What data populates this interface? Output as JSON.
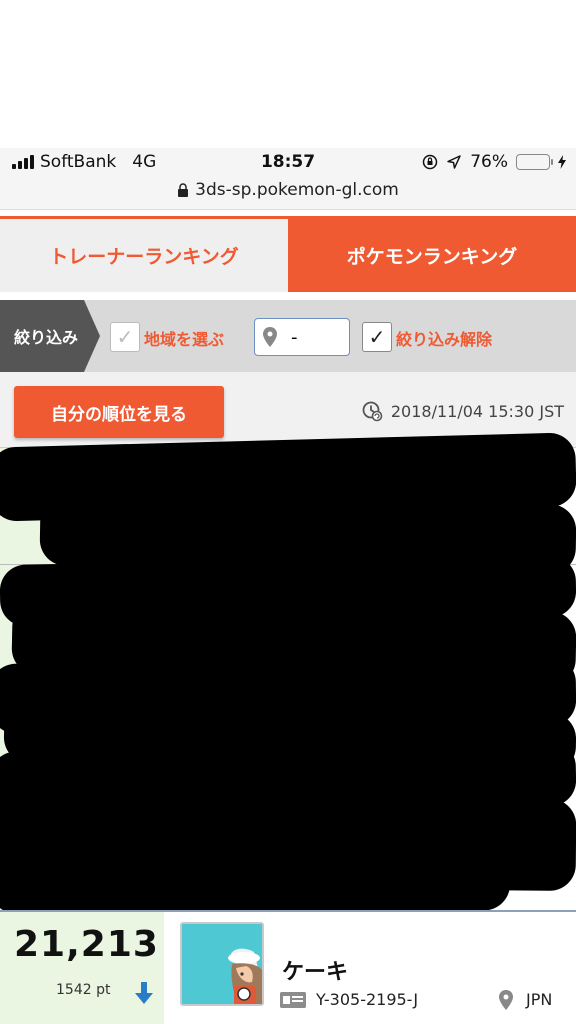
{
  "status_bar": {
    "carrier": "SoftBank",
    "network": "4G",
    "time": "18:57",
    "battery": "76%",
    "battery_level": 0.76
  },
  "browser": {
    "url": "3ds-sp.pokemon-gl.com"
  },
  "tabs": [
    {
      "label": "トレーナーランキング",
      "active": false
    },
    {
      "label": "ポケモンランキング",
      "active": true
    }
  ],
  "filter": {
    "label": "絞り込み",
    "region_checkbox_label": "地域を選ぶ",
    "region_value": "-",
    "clear_checkbox_label": "絞り込み解除"
  },
  "actions": {
    "my_rank_button": "自分の順位を見る",
    "updated_at": "2018/11/04 15:30 JST"
  },
  "entry": {
    "rank": "21,213",
    "points": "1542 pt",
    "trend": "down",
    "name": "ケーキ",
    "player_id": "Y-305-2195-J",
    "country": "JPN"
  },
  "colors": {
    "accent": "#ef5a33",
    "rank_bg": "#eaf6e2",
    "trend_down": "#2a7cc7"
  }
}
